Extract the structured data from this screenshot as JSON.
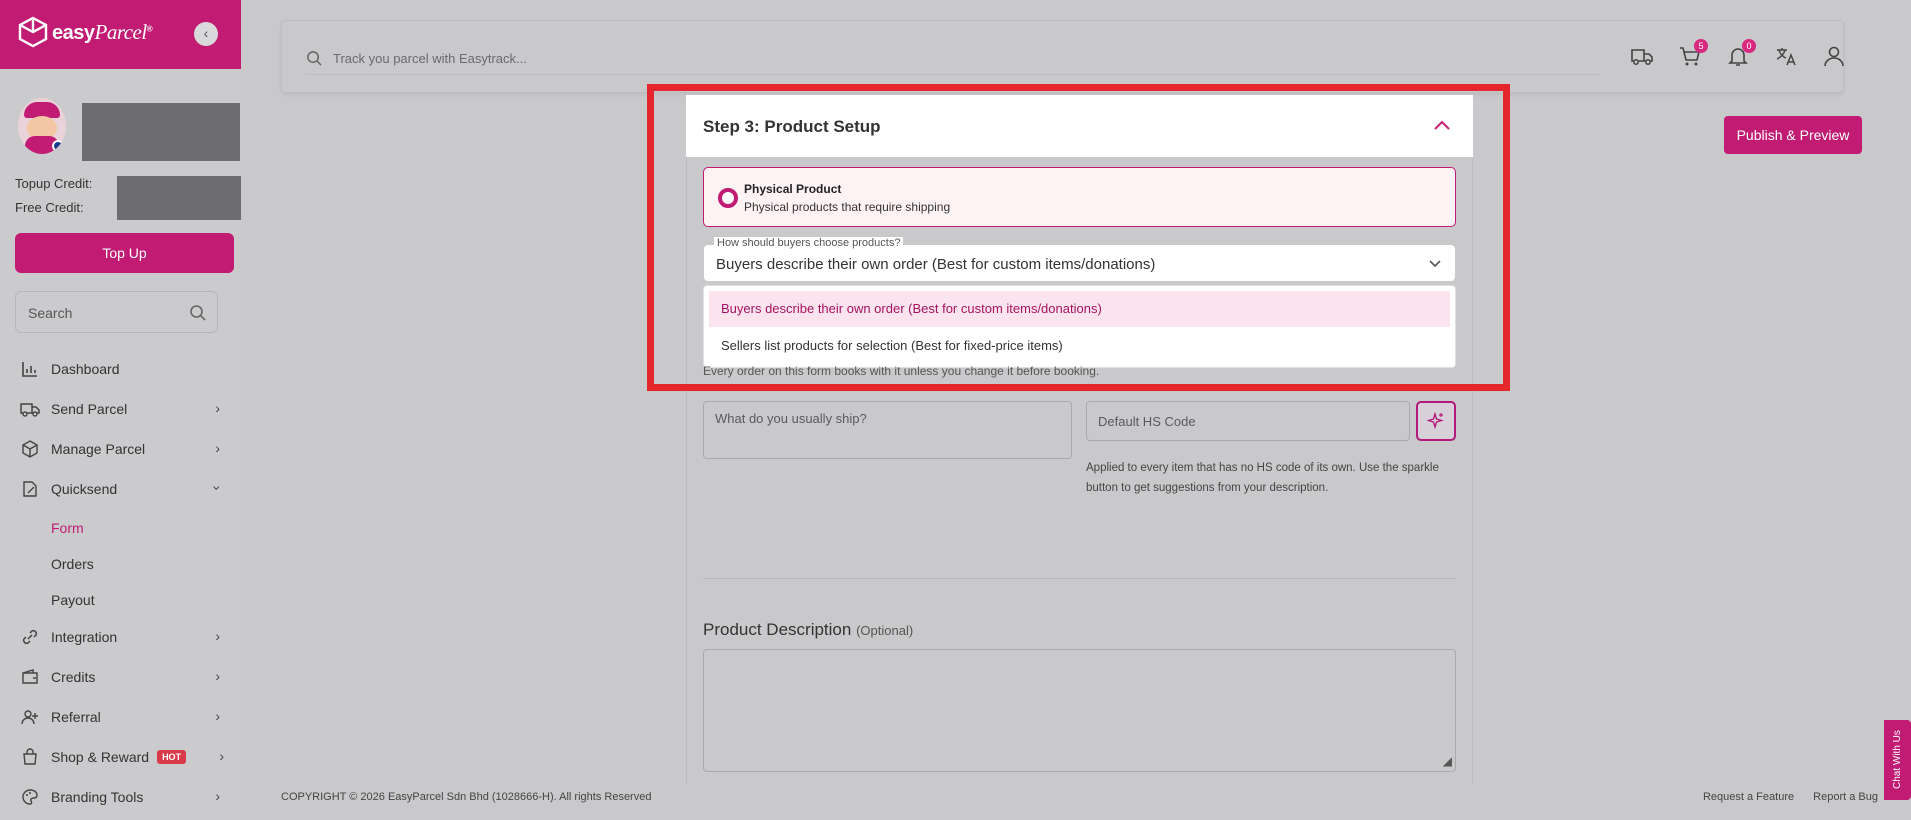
{
  "brand": {
    "name_bold": "easy",
    "name_script": "Parcel",
    "trademark": "®"
  },
  "sidebar": {
    "topup_credit_label": "Topup Credit:",
    "free_credit_label": "Free Credit:",
    "topup_button": "Top Up",
    "search_placeholder": "Search",
    "items": [
      {
        "label": "Dashboard",
        "icon": "chart-icon"
      },
      {
        "label": "Send Parcel",
        "icon": "truck-icon"
      },
      {
        "label": "Manage Parcel",
        "icon": "box-icon"
      },
      {
        "label": "Quicksend",
        "icon": "edit-icon"
      },
      {
        "label": "Integration",
        "icon": "link-icon"
      },
      {
        "label": "Credits",
        "icon": "wallet-icon"
      },
      {
        "label": "Referral",
        "icon": "user-add-icon"
      },
      {
        "label": "Shop & Reward",
        "icon": "bag-icon",
        "badge": "HOT"
      },
      {
        "label": "Branding Tools",
        "icon": "palette-icon"
      }
    ],
    "sub_items": [
      "Form",
      "Orders",
      "Payout"
    ]
  },
  "topbar": {
    "track_placeholder": "Track you parcel with Easytrack...",
    "cart_count": "5",
    "notif_count": "0"
  },
  "publish_button": "Publish & Preview",
  "step": {
    "title": "Step 3: Product Setup",
    "product_type_title": "Physical Product",
    "product_type_desc": "Physical products that require shipping",
    "choose_label": "How should buyers choose products?",
    "choose_value": "Buyers describe their own order (Best for custom items/donations)",
    "options": [
      "Buyers describe their own order (Best for custom items/donations)",
      "Sellers list products for selection (Best for fixed-price items)"
    ],
    "note": "Every order on this form books with it unless you change it before booking.",
    "ship_placeholder": "What do you usually ship?",
    "hs_placeholder": "Default HS Code",
    "hs_note": "Applied to every item that has no HS code of its own. Use the sparkle button to get suggestions from your description.",
    "desc_title": "Product Description",
    "desc_optional": "(Optional)"
  },
  "footer": {
    "copyright": "COPYRIGHT © 2026 EasyParcel Sdn Bhd (1028666-H). All rights Reserved",
    "request": "Request a Feature",
    "report": "Report a Bug"
  },
  "chat": "Chat With Us",
  "colors": {
    "brand": "#c11b73",
    "highlight": "#e5262c"
  }
}
